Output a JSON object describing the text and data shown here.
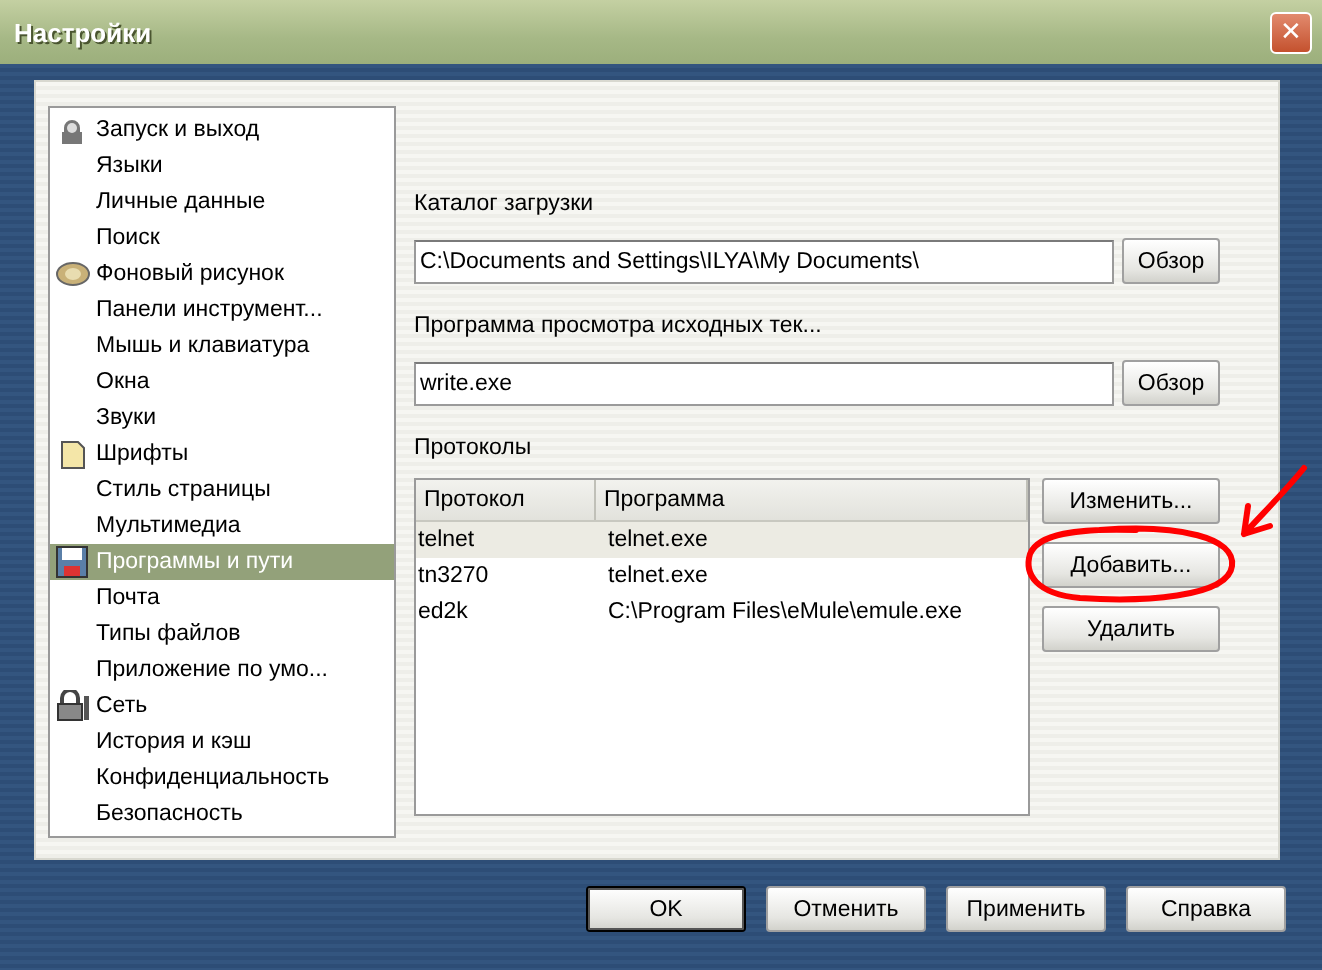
{
  "window": {
    "title": "Настройки",
    "close": "✕"
  },
  "sidebar": {
    "items": [
      {
        "label": "Запуск и выход",
        "kind": "person",
        "selected": false
      },
      {
        "label": "Языки",
        "kind": "plain",
        "selected": false
      },
      {
        "label": "Личные данные",
        "kind": "plain",
        "selected": false
      },
      {
        "label": "Поиск",
        "kind": "plain",
        "selected": false
      },
      {
        "label": "Фоновый рисунок",
        "kind": "picture",
        "selected": false
      },
      {
        "label": "Панели инструмент...",
        "kind": "plain",
        "selected": false
      },
      {
        "label": "Мышь и клавиатура",
        "kind": "plain",
        "selected": false
      },
      {
        "label": "Окна",
        "kind": "plain",
        "selected": false
      },
      {
        "label": "Звуки",
        "kind": "plain",
        "selected": false
      },
      {
        "label": "Шрифты",
        "kind": "page",
        "selected": false
      },
      {
        "label": "Стиль страницы",
        "kind": "plain",
        "selected": false
      },
      {
        "label": "Мультимедиа",
        "kind": "plain",
        "selected": false
      },
      {
        "label": "Программы и пути",
        "kind": "disk",
        "selected": true
      },
      {
        "label": "Почта",
        "kind": "plain",
        "selected": false
      },
      {
        "label": "Типы файлов",
        "kind": "plain",
        "selected": false
      },
      {
        "label": "Приложение по умо...",
        "kind": "plain",
        "selected": false
      },
      {
        "label": "Сеть",
        "kind": "lock",
        "selected": false
      },
      {
        "label": "История и кэш",
        "kind": "plain",
        "selected": false
      },
      {
        "label": "Конфиденциальность",
        "kind": "plain",
        "selected": false
      },
      {
        "label": "Безопасность",
        "kind": "plain",
        "selected": false
      }
    ]
  },
  "fields": [
    {
      "label": "Каталог загрузки",
      "value": "C:\\Documents and Settings\\ILYA\\My Documents\\",
      "button": "Обзор"
    },
    {
      "label": "Программа просмотра исходных тек...",
      "value": "write.exe",
      "button": "Обзор"
    }
  ],
  "protocols": {
    "label": "Протоколы",
    "table": {
      "columns": [
        "Протокол",
        "Программа"
      ],
      "rows": [
        {
          "cells": [
            "telnet",
            "telnet.exe"
          ],
          "selected": true
        },
        {
          "cells": [
            "tn3270",
            "telnet.exe"
          ],
          "selected": false
        },
        {
          "cells": [
            "ed2k",
            "C:\\Program Files\\eMule\\emule.exe"
          ],
          "selected": false
        }
      ]
    },
    "buttons": [
      {
        "label": "Изменить...",
        "circled": false
      },
      {
        "label": "Добавить...",
        "circled": true
      },
      {
        "label": "Удалить",
        "circled": false
      }
    ]
  },
  "buttons": [
    {
      "label": "OK",
      "default": true
    },
    {
      "label": "Отменить",
      "default": false
    },
    {
      "label": "Применить",
      "default": false
    },
    {
      "label": "Справка",
      "default": false
    }
  ]
}
